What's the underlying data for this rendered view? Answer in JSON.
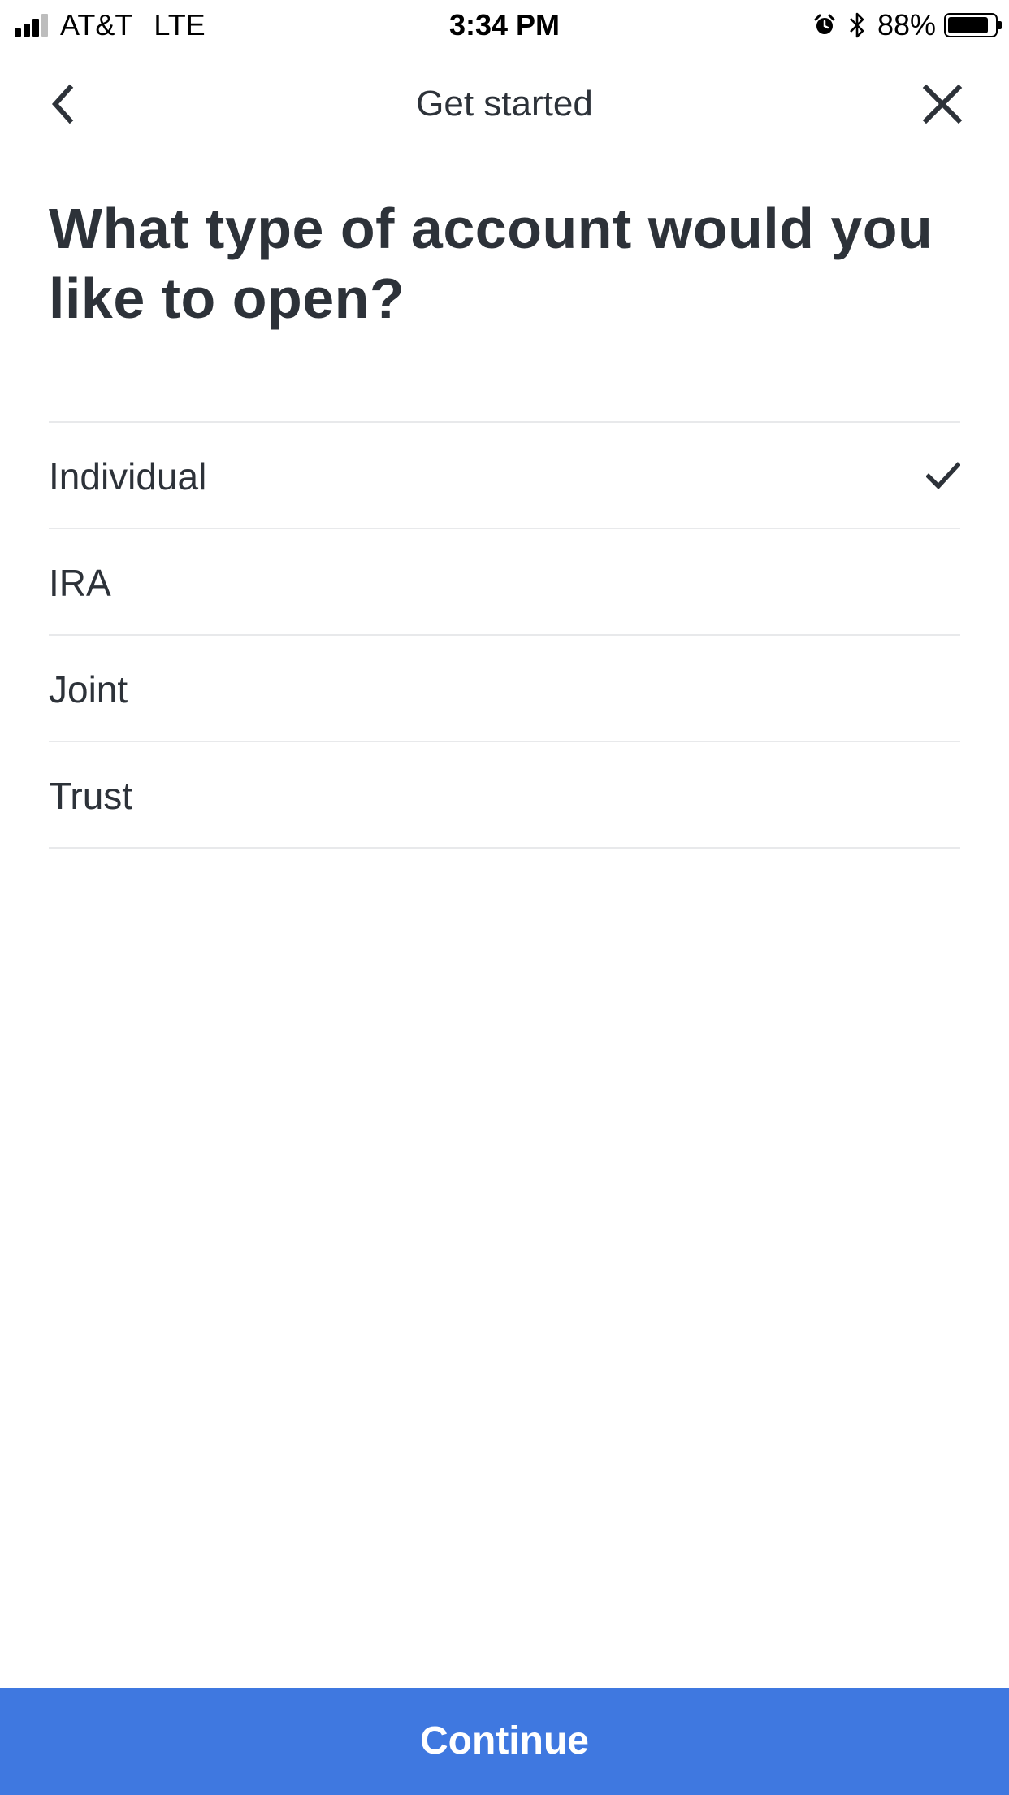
{
  "status_bar": {
    "carrier": "AT&T",
    "network": "LTE",
    "time": "3:34 PM",
    "battery_percent_label": "88%",
    "battery_level": 0.88,
    "signal_bars_filled": 3,
    "signal_bars_total": 4,
    "icons": [
      "signal-icon",
      "alarm-icon",
      "bluetooth-icon",
      "battery-icon"
    ]
  },
  "header": {
    "title": "Get started",
    "back_icon": "chevron-left-icon",
    "close_icon": "close-icon"
  },
  "question": "What type of account would you like to open?",
  "options": [
    {
      "label": "Individual",
      "selected": true
    },
    {
      "label": "IRA",
      "selected": false
    },
    {
      "label": "Joint",
      "selected": false
    },
    {
      "label": "Trust",
      "selected": false
    }
  ],
  "footer": {
    "continue_label": "Continue"
  },
  "colors": {
    "primary_button": "#3f78e0",
    "text": "#2d3239",
    "divider": "#e8e9eb"
  }
}
